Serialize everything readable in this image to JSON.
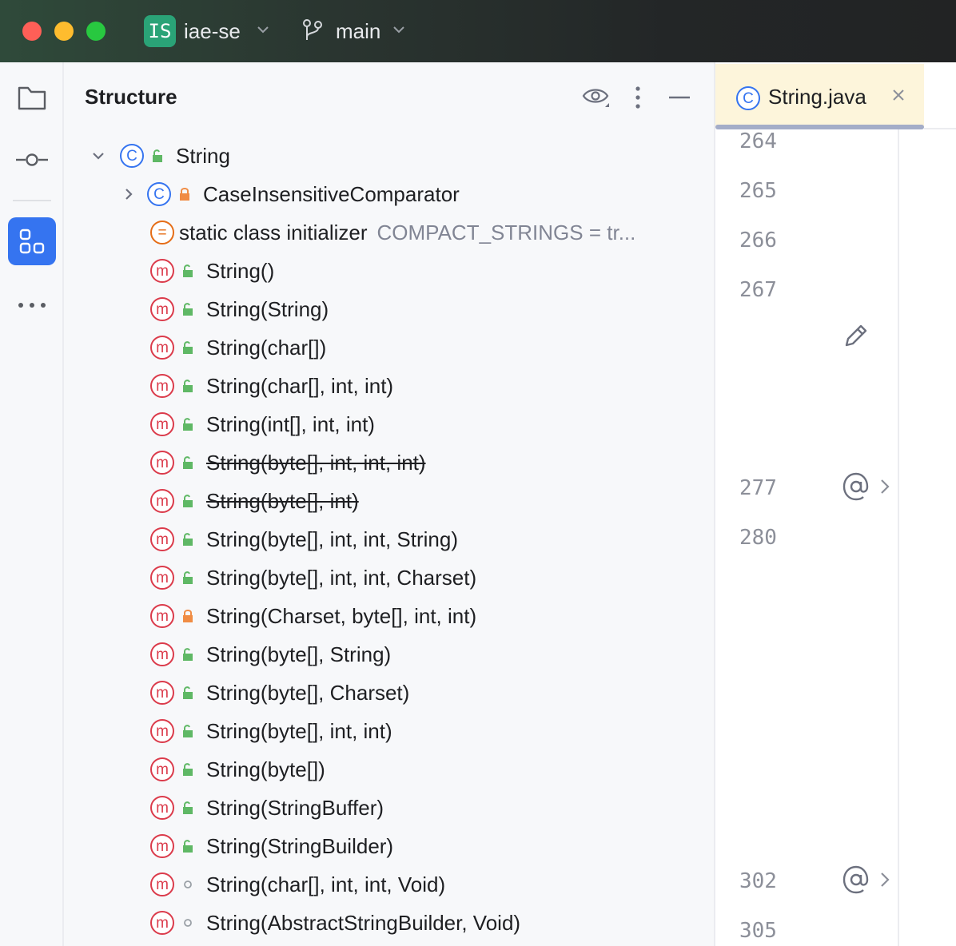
{
  "titlebar": {
    "project_badge": "IS",
    "project_name": "iae-se",
    "branch_name": "main"
  },
  "toolstrip": {
    "items": [
      "project-icon",
      "commit-icon",
      "structure-icon",
      "more-icon"
    ]
  },
  "panel": {
    "title": "Structure"
  },
  "tree": {
    "root": {
      "label": "String",
      "kind": "C",
      "visibility": "public",
      "expanded": true
    },
    "items": [
      {
        "label": "CaseInsensitiveComparator",
        "kind": "C",
        "visibility": "private",
        "collapsible": true,
        "strike": false
      },
      {
        "label": "static class initializer",
        "hint": "COMPACT_STRINGS = tr...",
        "kind": "=",
        "visibility": "none",
        "strike": false
      },
      {
        "label": "String()",
        "kind": "m",
        "visibility": "public",
        "strike": false
      },
      {
        "label": "String(String)",
        "kind": "m",
        "visibility": "public",
        "strike": false
      },
      {
        "label": "String(char[])",
        "kind": "m",
        "visibility": "public",
        "strike": false
      },
      {
        "label": "String(char[], int, int)",
        "kind": "m",
        "visibility": "public",
        "strike": false
      },
      {
        "label": "String(int[], int, int)",
        "kind": "m",
        "visibility": "public",
        "strike": false
      },
      {
        "label": "String(byte[], int, int, int)",
        "kind": "m",
        "visibility": "public",
        "strike": true
      },
      {
        "label": "String(byte[], int)",
        "kind": "m",
        "visibility": "public",
        "strike": true
      },
      {
        "label": "String(byte[], int, int, String)",
        "kind": "m",
        "visibility": "public",
        "strike": false
      },
      {
        "label": "String(byte[], int, int, Charset)",
        "kind": "m",
        "visibility": "public",
        "strike": false
      },
      {
        "label": "String(Charset, byte[], int, int)",
        "kind": "m",
        "visibility": "private",
        "strike": false
      },
      {
        "label": "String(byte[], String)",
        "kind": "m",
        "visibility": "public",
        "strike": false
      },
      {
        "label": "String(byte[], Charset)",
        "kind": "m",
        "visibility": "public",
        "strike": false
      },
      {
        "label": "String(byte[], int, int)",
        "kind": "m",
        "visibility": "public",
        "strike": false
      },
      {
        "label": "String(byte[])",
        "kind": "m",
        "visibility": "public",
        "strike": false
      },
      {
        "label": "String(StringBuffer)",
        "kind": "m",
        "visibility": "public",
        "strike": false
      },
      {
        "label": "String(StringBuilder)",
        "kind": "m",
        "visibility": "public",
        "strike": false
      },
      {
        "label": "String(char[], int, int, Void)",
        "kind": "m",
        "visibility": "package",
        "strike": false
      },
      {
        "label": "String(AbstractStringBuilder, Void)",
        "kind": "m",
        "visibility": "package",
        "strike": false
      }
    ]
  },
  "editor": {
    "tab_label": "String.java",
    "tab_kind": "C",
    "line_numbers": [
      {
        "num": "264"
      },
      {
        "num": "265"
      },
      {
        "num": "266"
      },
      {
        "num": "267"
      },
      {
        "num": "277"
      },
      {
        "num": "280"
      },
      {
        "num": "302"
      },
      {
        "num": "305"
      }
    ],
    "gutter_marks": [
      "edit-icon",
      "annotation-icon",
      "annotation-icon"
    ]
  },
  "colors": {
    "accent": "#3574f0",
    "method": "#db3b4b",
    "initializer": "#e56d17",
    "public": "#5fb865",
    "private": "#f08c44"
  }
}
